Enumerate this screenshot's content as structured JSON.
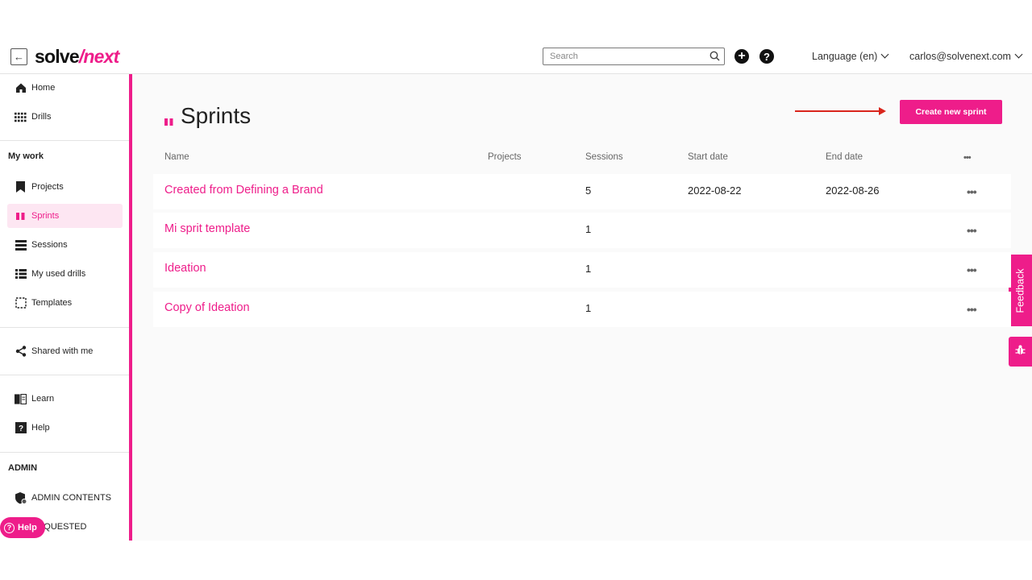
{
  "topbar": {
    "logo_part1": "solve",
    "logo_part2": "/next",
    "search_placeholder": "Search",
    "language": "Language (en)",
    "user_email": "carlos@solvenext.com"
  },
  "sidebar": {
    "items": [
      {
        "label": "Home",
        "icon": "home-icon"
      },
      {
        "label": "Drills",
        "icon": "grid-icon"
      },
      {
        "label": "Projects",
        "icon": "bookmark-icon"
      },
      {
        "label": "Sprints",
        "icon": "sprint-icon",
        "active": true
      },
      {
        "label": "Sessions",
        "icon": "stack-icon"
      },
      {
        "label": "My used drills",
        "icon": "list-icon"
      },
      {
        "label": "Templates",
        "icon": "template-icon"
      },
      {
        "label": "Shared with me",
        "icon": "share-icon"
      },
      {
        "label": "Learn",
        "icon": "book-icon"
      },
      {
        "label": "Help",
        "icon": "help-icon"
      },
      {
        "label": "ADMIN CONTENTS",
        "icon": "admin-shield-icon"
      },
      {
        "label": "REQUESTED",
        "icon": "request-icon"
      }
    ],
    "headings": {
      "my_work": "My work",
      "admin": "ADMIN"
    },
    "help_pill": "Help"
  },
  "main": {
    "title": "Sprints",
    "create_button": "Create new sprint",
    "columns": [
      "Name",
      "Projects",
      "Sessions",
      "Start date",
      "End date"
    ],
    "columns_menu": "•••",
    "rows": [
      {
        "name": "Created from Defining a Brand",
        "projects": "",
        "sessions": "5",
        "start_date": "2022-08-22",
        "end_date": "2022-08-26",
        "menu": "•••"
      },
      {
        "name": "Mi sprit template",
        "projects": "",
        "sessions": "1",
        "start_date": "",
        "end_date": "",
        "menu": "•••"
      },
      {
        "name": "Ideation",
        "projects": "",
        "sessions": "1",
        "start_date": "",
        "end_date": "",
        "menu": "•••"
      },
      {
        "name": "Copy of Ideation",
        "projects": "",
        "sessions": "1",
        "start_date": "",
        "end_date": "",
        "menu": "•••"
      }
    ]
  },
  "feedback_tab": "Feedback",
  "colors": {
    "accent": "#ee1d8a",
    "annotation_arrow": "#d9251c"
  }
}
